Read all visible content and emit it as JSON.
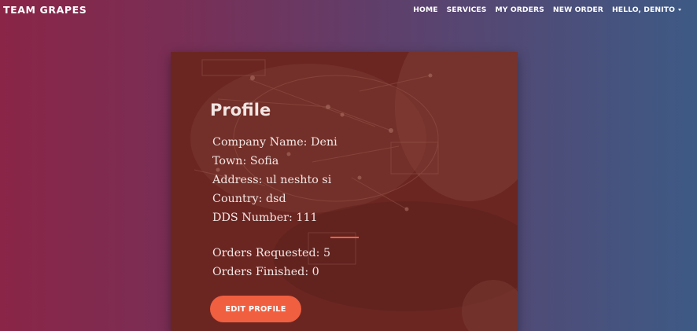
{
  "navbar": {
    "brand": "TEAM GRAPES",
    "links": [
      {
        "label": "HOME"
      },
      {
        "label": "SERVICES"
      },
      {
        "label": "MY ORDERS"
      },
      {
        "label": "NEW ORDER"
      },
      {
        "label": "HELLO, DENITO"
      }
    ]
  },
  "profile": {
    "title": "Profile",
    "company_name": "Company Name: Deni",
    "town": "Town: Sofia",
    "address": "Address: ul neshto si",
    "country": "Country: dsd",
    "dds_number": "DDS Number: 111",
    "orders_requested": "Orders Requested: 5",
    "orders_finished": "Orders Finished: 0",
    "edit_button_label": "EDIT PROFILE"
  },
  "colors": {
    "accent": "#f05f40",
    "card_background": "#6b2622",
    "gradient_left": "#8a2547",
    "gradient_right": "#3d5a85"
  },
  "icons": {
    "user_menu_caret": "caret-down-icon"
  }
}
